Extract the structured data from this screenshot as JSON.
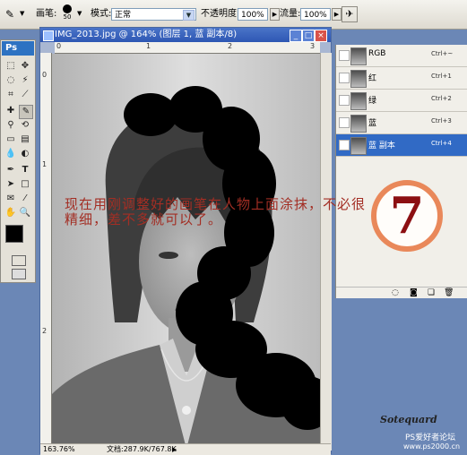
{
  "options_bar": {
    "brush_label": "画笔:",
    "brush_size": "50",
    "mode_label": "模式:",
    "mode_value": "正常",
    "opacity_label": "不透明度:",
    "opacity_value": "100%",
    "flow_label": "流量:",
    "flow_value": "100%"
  },
  "toolbox": {
    "logo": "Ps"
  },
  "document": {
    "title": "IMG_2013.jpg @ 164% (图层 1, 蓝 副本/8)",
    "ruler_top": [
      "0",
      "1",
      "2",
      "3"
    ],
    "ruler_left": [
      "0",
      "1",
      "2"
    ],
    "zoom": "163.76%",
    "doc_size": "文档:287.9K/767.8K"
  },
  "channels": [
    {
      "name": "RGB",
      "shortcut": "Ctrl+~",
      "visible": false,
      "selected": false
    },
    {
      "name": "红",
      "shortcut": "Ctrl+1",
      "visible": false,
      "selected": false
    },
    {
      "name": "绿",
      "shortcut": "Ctrl+2",
      "visible": false,
      "selected": false
    },
    {
      "name": "蓝",
      "shortcut": "Ctrl+3",
      "visible": false,
      "selected": false
    },
    {
      "name": "蓝 副本",
      "shortcut": "Ctrl+4",
      "visible": true,
      "selected": true
    }
  ],
  "instruction_text": "现在用刚调整好的画笔在人物上面涂抹，不必很精细，差不多就可以了。",
  "step_number": "7",
  "watermark": {
    "signature": "Sotequard",
    "forum": "PS爱好者论坛",
    "url": "www.ps2000.cn"
  },
  "colors": {
    "accent": "#316ac5",
    "title_bar": "#2e57b3",
    "annotation": "#a32e24",
    "badge_ring": "#e9885a",
    "badge_number": "#8c0f12"
  }
}
